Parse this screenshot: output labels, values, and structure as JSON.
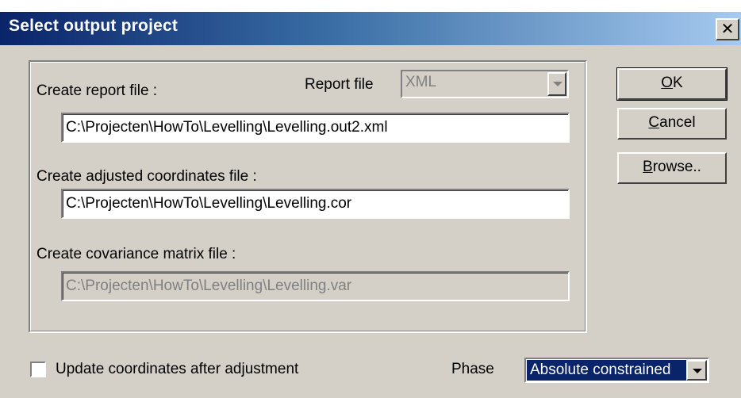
{
  "window": {
    "title": "Select output project",
    "close_glyph": "✕"
  },
  "group": {
    "report_label": "Create report file :",
    "report_type_label": "Report file",
    "report_type_value": "XML",
    "report_path": "C:\\Projecten\\HowTo\\Levelling\\Levelling.out2.xml",
    "coords_label": "Create adjusted coordinates file :",
    "coords_path": "C:\\Projecten\\HowTo\\Levelling\\Levelling.cor",
    "cov_label": "Create covariance matrix file :",
    "cov_path": "C:\\Projecten\\HowTo\\Levelling\\Levelling.var"
  },
  "buttons": {
    "ok": {
      "mnemonic": "O",
      "rest": "K"
    },
    "cancel": {
      "mnemonic": "C",
      "rest": "ancel"
    },
    "browse": {
      "mnemonic": "B",
      "rest": "rowse.."
    }
  },
  "footer": {
    "update_label": "Update coordinates after adjustment",
    "update_checked": false,
    "phase_label": "Phase",
    "phase_value": "Absolute constrained"
  },
  "icons": {
    "dropdown": "chevron-down-icon",
    "close": "close-icon",
    "checkbox": "checkbox-icon"
  }
}
